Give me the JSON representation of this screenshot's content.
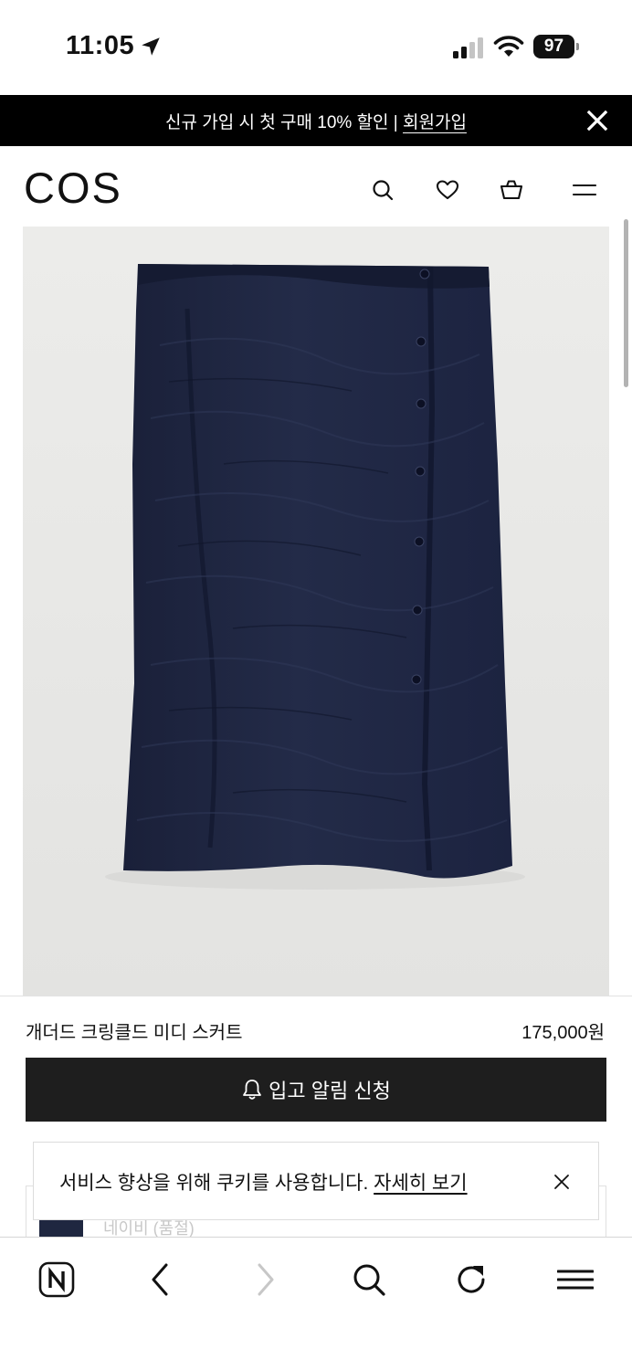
{
  "status_bar": {
    "time": "11:05",
    "battery": "97",
    "icons": [
      "location-arrow-icon",
      "signal-icon",
      "wifi-icon",
      "battery-icon"
    ]
  },
  "promo_banner": {
    "text": "신규 가입 시 첫 구매 10% 할인 | ",
    "link": "회원가입",
    "close_icon": "close-icon"
  },
  "header": {
    "logo": "COS",
    "icons": [
      "search-icon",
      "heart-icon",
      "bag-icon",
      "menu-icon"
    ]
  },
  "product": {
    "image_alt": "navy gathered crinkled midi skirt",
    "image_bg": "#e8e8e6",
    "garment_color": "#1e2540",
    "name": "개더드 크링클드 미디 스커트",
    "price": "175,000원",
    "notify_button": "입고 알림 신청",
    "notify_icon": "bell-icon"
  },
  "partial_content": {
    "text": "네이비 (품절)"
  },
  "cookie_notice": {
    "text": "서비스 향상을 위해 쿠키를 사용합니다. ",
    "link": "자세히 보기",
    "close_icon": "close-icon"
  },
  "browser_toolbar": {
    "icons": [
      "naver-home-icon",
      "back-icon",
      "forward-icon",
      "search-icon",
      "refresh-icon",
      "menu-icon"
    ]
  }
}
